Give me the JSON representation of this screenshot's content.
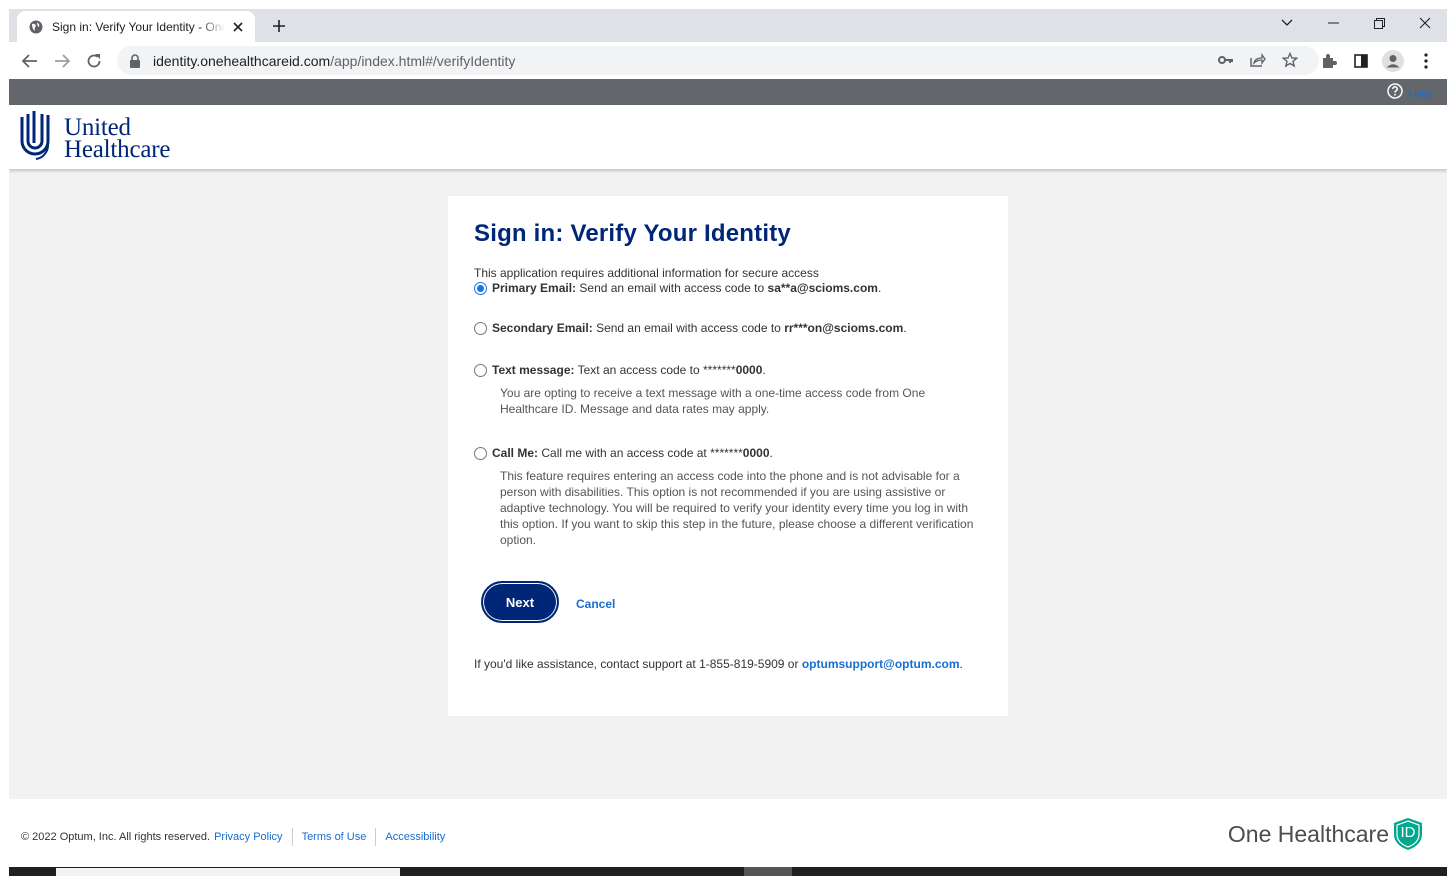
{
  "browser": {
    "tab_title": "Sign in: Verify Your Identity - One Healthcare ID",
    "url_host": "identity.onehealthcareid.com",
    "url_path": "/app/index.html#/verifyIdentity"
  },
  "helpbar": {
    "help_label": "Help"
  },
  "header": {
    "brand_line1": "United",
    "brand_line2": "Healthcare"
  },
  "card": {
    "title": "Sign in: Verify Your Identity",
    "intro": "This application requires additional information for secure access",
    "options": [
      {
        "label": "Primary Email:",
        "text": "Send an email with access code to",
        "target": "sa**a@scioms.com",
        "suffix": ".",
        "checked": true
      },
      {
        "label": "Secondary Email:",
        "text": "Send an email with access code to",
        "target": "rr***on@scioms.com",
        "suffix": ".",
        "checked": false
      },
      {
        "label": "Text message:",
        "text": "Text an access code to *******",
        "target": "0000",
        "suffix": ".",
        "checked": false,
        "note": "You are opting to receive a text message with a one-time access code from One Healthcare ID. Message and data rates may apply."
      },
      {
        "label": "Call Me:",
        "text": "Call me with an access code at *******",
        "target": "0000",
        "suffix": ".",
        "checked": false,
        "note": "This feature requires entering an access code into the phone and is not advisable for a person with disabilities. This option is not recommended if you are using assistive or adaptive technology. You will be required to verify your identity every time you log in with this option. If you want to skip this step in the future, please choose a different verification option."
      }
    ],
    "next_label": "Next",
    "cancel_label": "Cancel",
    "assist_text": "If you'd like assistance, contact support at 1-855-819-5909 or",
    "assist_email": "optumsupport@optum.com",
    "assist_suffix": "."
  },
  "footer": {
    "copyright": "© 2022 Optum, Inc. All rights reserved.",
    "privacy": "Privacy Policy",
    "terms": "Terms of Use",
    "accessibility": "Accessibility",
    "brand": "One Healthcare",
    "brand_badge": "ID"
  },
  "colors": {
    "navy": "#002677",
    "link": "#196ecf",
    "helpbar": "#63666a",
    "page_bg": "#f2f2f2",
    "brand_teal": "#00a88e"
  }
}
